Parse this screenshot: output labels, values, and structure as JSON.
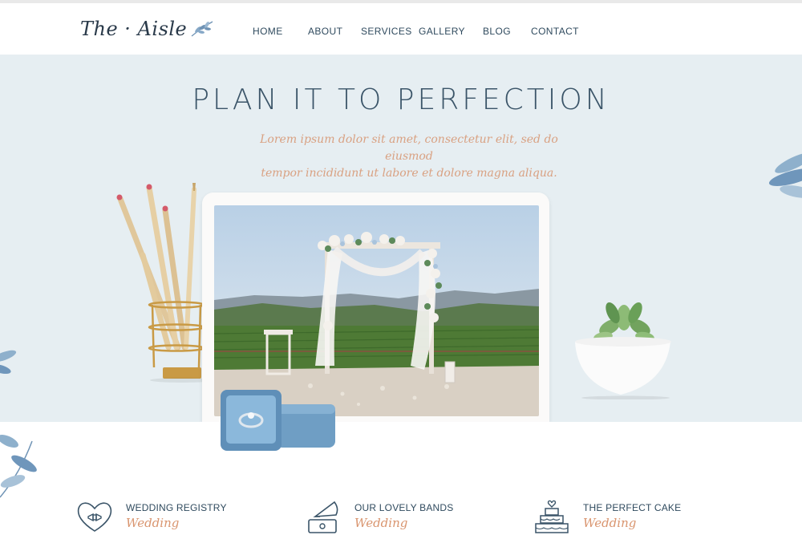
{
  "brand": {
    "logo_text": "The · Aisle",
    "accent_color": "#d9956f",
    "primary_color": "#2f4a5e",
    "hero_bg": "#e6eef2"
  },
  "nav": {
    "items": [
      {
        "label": "HOME"
      },
      {
        "label": "ABOUT"
      },
      {
        "label": "SERVICES"
      },
      {
        "label": "GALLERY"
      },
      {
        "label": "BLOG"
      },
      {
        "label": "CONTACT"
      }
    ]
  },
  "hero": {
    "title": "PLAN IT TO PERFECTION",
    "subtitle_line1": "Lorem ipsum dolor sit amet, consectetur elit, sed do eiusmod",
    "subtitle_line2": "tempor incididunt ut labore et dolore magna aliqua."
  },
  "features": [
    {
      "title": "WEDDING REGISTRY",
      "subtitle": "Wedding",
      "icon": "heart-bowtie-icon"
    },
    {
      "title": "OUR LOVELY BANDS",
      "subtitle": "Wedding",
      "icon": "gramophone-icon"
    },
    {
      "title": "THE PERFECT CAKE",
      "subtitle": "Wedding",
      "icon": "wedding-cake-icon"
    }
  ]
}
